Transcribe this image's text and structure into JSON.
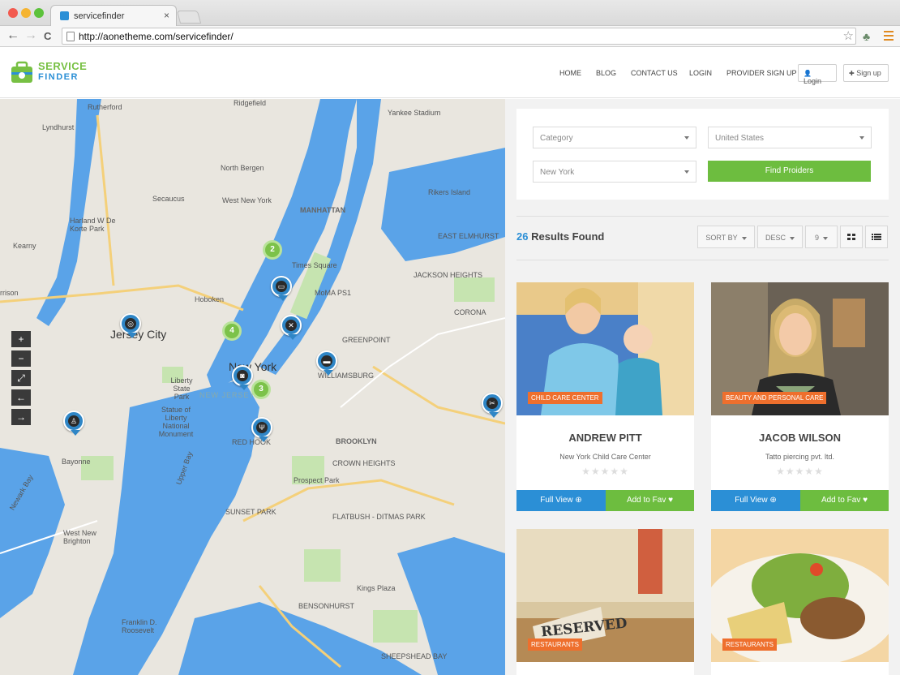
{
  "browser": {
    "tab_title": "servicefinder",
    "tab_close": "×",
    "back_glyph": "←",
    "forward_glyph": "→",
    "reload_glyph": "C",
    "url": "http://aonetheme.com/servicefinder/",
    "star_glyph": "☆",
    "extension_glyph": "♣"
  },
  "header": {
    "logo_line1": "SERVICE",
    "logo_line2": "FINDER",
    "nav": [
      "HOME",
      "BLOG",
      "CONTACT US",
      "LOGIN",
      "PROVIDER SIGN UP"
    ],
    "login_btn": "Login",
    "signup_btn": "Sign up",
    "login_glyph": "👤",
    "signup_glyph": "✚"
  },
  "map": {
    "zoom_in": "+",
    "zoom_out": "−",
    "fullscreen": "⤢",
    "prev": "←",
    "next": "→",
    "labels": [
      "Rutherford",
      "Ridgefield",
      "Lyndhurst",
      "North Bergen",
      "Secaucus",
      "West New York",
      "Harland W De Korte Park",
      "Kearny",
      "Hoboken",
      "Jersey City",
      "Liberty State Park",
      "Statue of Liberty National Monument",
      "New York",
      "Bayonne",
      "BROOKLYN",
      "CROWN HEIGHTS",
      "Prospect Park",
      "SUNSET PARK",
      "FLATBUSH - DITMAS PARK",
      "West New Brighton",
      "Kings Plaza",
      "MANHATTAN",
      "Times Square",
      "MoMA PS1",
      "Yankee Stadium",
      "Rikers Island",
      "EAST ELMHURST",
      "GREENPOINT",
      "WILLIAMSBURG",
      "RED HOOK",
      "NEW JERSEY",
      "Upper Bay",
      "Newark Bay",
      "rrison",
      "Franklin D. Roosevelt",
      "CORONA",
      "JACKSON HEIGHTS",
      "SHEEPSHEAD BAY",
      "BENSONHURST"
    ],
    "clusters": [
      "2",
      "4",
      "3"
    ]
  },
  "search": {
    "category": "Category",
    "country": "United States",
    "city": "New York",
    "find_button": "Find Proiders"
  },
  "results": {
    "count": "26",
    "label": "Results Found",
    "sort_by": "SORT BY",
    "order": "DESC",
    "per_page": "9",
    "grid_glyph": "▦",
    "list_glyph": "☰"
  },
  "cards": [
    {
      "tag": "CHILD CARE CENTER",
      "name": "ANDREW PITT",
      "company": "New York Child Care Center",
      "stars": "★★★★★",
      "full_view": "Full View ⊕",
      "add_fav": "Add to Fav ♥"
    },
    {
      "tag": "BEAUTY AND PERSONAL CARE",
      "name": "JACOB WILSON",
      "company": "Tatto piercing pvt. ltd.",
      "stars": "★★★★★",
      "full_view": "Full View ⊕",
      "add_fav": "Add to Fav ♥"
    },
    {
      "tag": "RESTAURANTS",
      "sign": "RESERVED"
    },
    {
      "tag": "RESTAURANTS"
    }
  ],
  "colors": {
    "accent_blue": "#2b8fd6",
    "accent_green": "#6dbd3f",
    "tag_orange": "#ee6f2d"
  }
}
